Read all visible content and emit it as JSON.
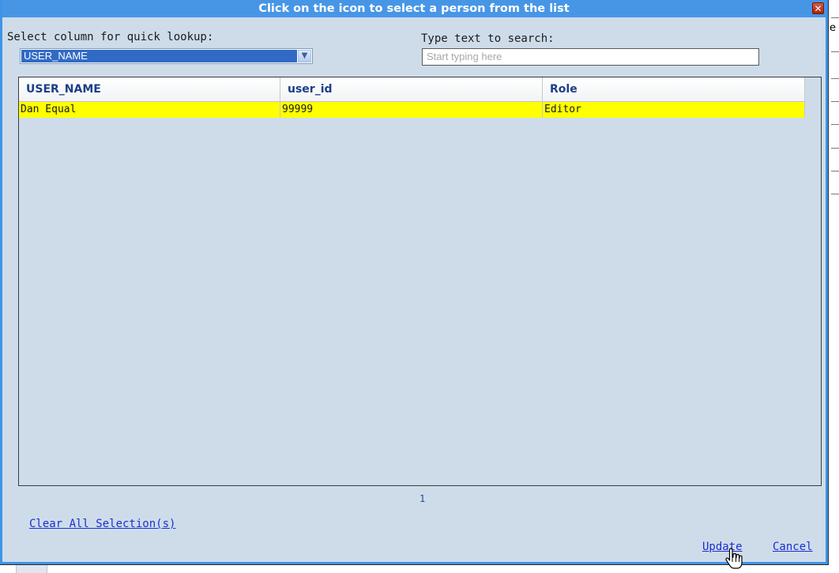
{
  "dialog": {
    "title": "Click on the icon to select a person from the list",
    "close_glyph": "✕",
    "close_icon": "close-icon"
  },
  "lookup": {
    "label": "Select column for quick lookup:",
    "selected": "USER_NAME",
    "dropdown_icon": "chevron-down-icon"
  },
  "search": {
    "label": "Type text to search:",
    "placeholder": "Start typing here"
  },
  "grid": {
    "columns": [
      "USER_NAME",
      "user_id",
      "Role"
    ],
    "rows": [
      [
        "Dan Equal",
        "99999",
        "Editor"
      ]
    ],
    "highlight_color": "#ffff00"
  },
  "pager": {
    "current_page": "1"
  },
  "actions": {
    "clear_all": "Clear All Selection(s)",
    "update": "Update",
    "cancel": "Cancel"
  },
  "background": {
    "fragment_char": "e"
  },
  "colors": {
    "titlebar": "#4796e6",
    "dialog_bg": "#cedcea",
    "link": "#1a2fd0",
    "header_text": "#1c3f86"
  }
}
